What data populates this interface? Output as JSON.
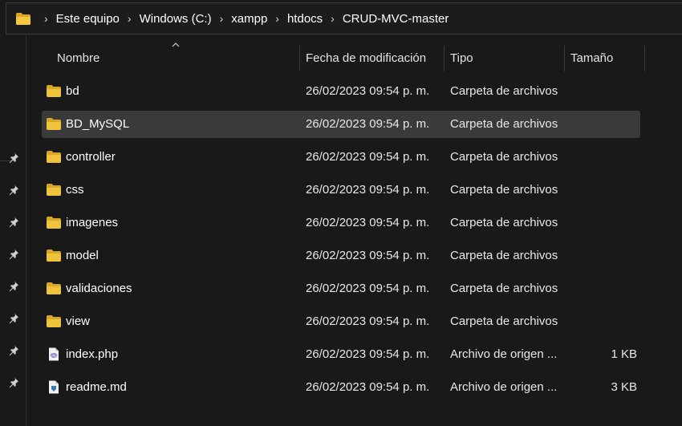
{
  "breadcrumb": [
    {
      "label": "Este equipo"
    },
    {
      "label": "Windows (C:)"
    },
    {
      "label": "xampp"
    },
    {
      "label": "htdocs"
    },
    {
      "label": "CRUD-MVC-master"
    }
  ],
  "breadcrumb_separator": "›",
  "columns": {
    "name": "Nombre",
    "date": "Fecha de modificación",
    "type": "Tipo",
    "size": "Tamaño"
  },
  "sort": {
    "column": "name",
    "direction": "ascending",
    "indicator": "chevron-up-icon"
  },
  "files": [
    {
      "name": "bd",
      "date": "26/02/2023 09:54 p. m.",
      "type": "Carpeta de archivos",
      "size": "",
      "icon": "folder-icon",
      "selected": false
    },
    {
      "name": "BD_MySQL",
      "date": "26/02/2023 09:54 p. m.",
      "type": "Carpeta de archivos",
      "size": "",
      "icon": "folder-icon",
      "selected": true
    },
    {
      "name": "controller",
      "date": "26/02/2023 09:54 p. m.",
      "type": "Carpeta de archivos",
      "size": "",
      "icon": "folder-icon",
      "selected": false
    },
    {
      "name": "css",
      "date": "26/02/2023 09:54 p. m.",
      "type": "Carpeta de archivos",
      "size": "",
      "icon": "folder-icon",
      "selected": false
    },
    {
      "name": "imagenes",
      "date": "26/02/2023 09:54 p. m.",
      "type": "Carpeta de archivos",
      "size": "",
      "icon": "folder-icon",
      "selected": false
    },
    {
      "name": "model",
      "date": "26/02/2023 09:54 p. m.",
      "type": "Carpeta de archivos",
      "size": "",
      "icon": "folder-icon",
      "selected": false
    },
    {
      "name": "validaciones",
      "date": "26/02/2023 09:54 p. m.",
      "type": "Carpeta de archivos",
      "size": "",
      "icon": "folder-icon",
      "selected": false
    },
    {
      "name": "view",
      "date": "26/02/2023 09:54 p. m.",
      "type": "Carpeta de archivos",
      "size": "",
      "icon": "folder-icon",
      "selected": false
    },
    {
      "name": "index.php",
      "date": "26/02/2023 09:54 p. m.",
      "type": "Archivo de origen ...",
      "size": "1 KB",
      "icon": "php-file-icon",
      "selected": false
    },
    {
      "name": "readme.md",
      "date": "26/02/2023 09:54 p. m.",
      "type": "Archivo de origen ...",
      "size": "3 KB",
      "icon": "markdown-file-icon",
      "selected": false
    }
  ],
  "quick_access_pins": 8,
  "colors": {
    "background": "#191919",
    "selected_row": "#3a3a3a",
    "folder": "#f0c33c",
    "text": "#ffffff"
  }
}
